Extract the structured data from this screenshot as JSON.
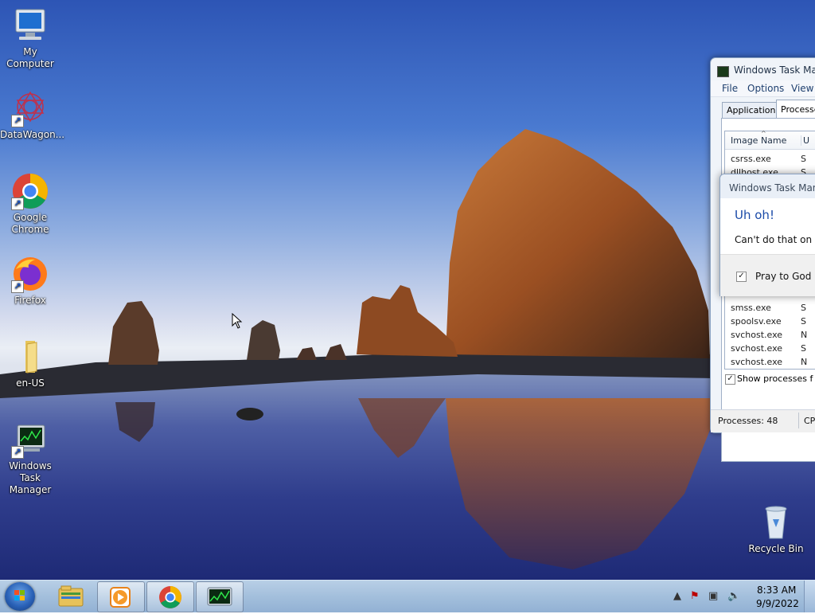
{
  "desktop": {
    "icons": [
      {
        "label": "My Computer",
        "icon": "computer-icon"
      },
      {
        "label": "DataWagon...",
        "icon": "datawagon-icon"
      },
      {
        "label": "Google Chrome",
        "icon": "chrome-icon"
      },
      {
        "label": "Firefox",
        "icon": "firefox-icon"
      },
      {
        "label": "en-US",
        "icon": "folder-icon"
      },
      {
        "label": "Windows Task Manager",
        "icon": "task-manager-icon"
      },
      {
        "label": "Recycle Bin",
        "icon": "recycle-bin-icon"
      }
    ]
  },
  "task_manager": {
    "title": "Windows Task Mana",
    "menu": [
      "File",
      "Options",
      "View"
    ],
    "tabs": [
      "Applications",
      "Processe"
    ],
    "columns": [
      "Image Name",
      "U"
    ],
    "processes_top": [
      {
        "name": "csrss.exe",
        "user": "S"
      },
      {
        "name": "dllhost.exe",
        "user": "S"
      }
    ],
    "processes_bottom": [
      {
        "name": "smss.exe",
        "user": "S"
      },
      {
        "name": "spoolsv.exe",
        "user": "S"
      },
      {
        "name": "svchost.exe",
        "user": "N"
      },
      {
        "name": "svchost.exe",
        "user": "S"
      },
      {
        "name": "svchost.exe",
        "user": "N"
      }
    ],
    "show_all_label": "Show processes f",
    "status_processes": "Processes: 48",
    "status_cpu": "CP"
  },
  "dialog": {
    "title": "Windows Task Mana",
    "heading": "Uh oh!",
    "message": "Can't do that on a C",
    "checkbox_label": "Pray to God",
    "checkbox_checked": true
  },
  "taskbar": {
    "time": "8:33 AM",
    "date": "9/9/2022",
    "pinned": [
      "explorer-icon",
      "media-player-icon",
      "chrome-icon",
      "task-manager-icon"
    ]
  },
  "colors": {
    "accent_heading": "#1a4aa8",
    "taskbar": "#a3bfdc"
  }
}
